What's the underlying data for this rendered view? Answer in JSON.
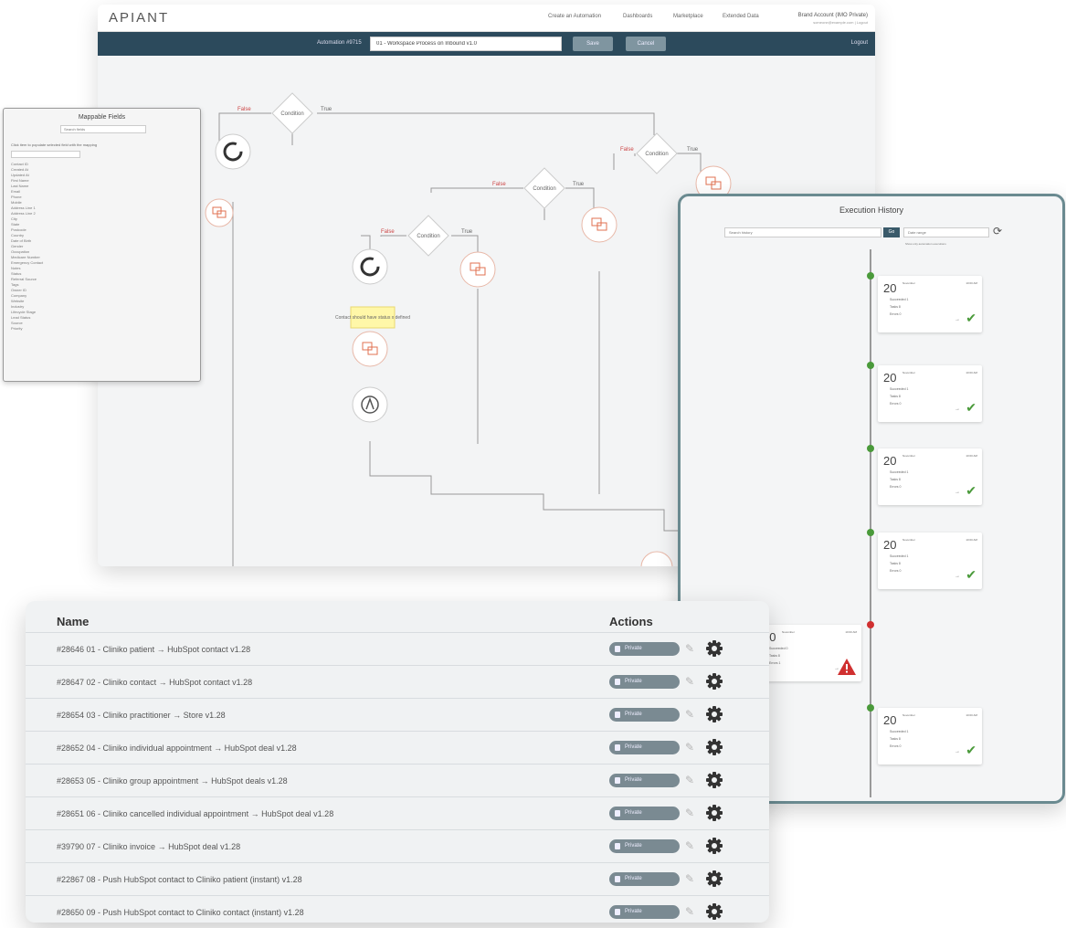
{
  "editor": {
    "logo": "APIANT",
    "nav": [
      "Create an Automation",
      "Dashboards",
      "Marketplace",
      "Extended Data"
    ],
    "user": "Brand Account (IMO Private)",
    "user_sub": "someone@example.com | Logout",
    "automation_label": "Automation #9715",
    "automation_name": "01 - Workspace Process on Inbound v1.0",
    "save_label": "Save",
    "cancel_label": "Cancel",
    "logout_label": "Logout",
    "diagram": {
      "condition_label": "Condition",
      "false_label": "False",
      "true_label": "True",
      "yellow_note": "Contact should have status x defined"
    }
  },
  "mappable": {
    "title": "Mappable Fields",
    "search_placeholder": "Search fields",
    "description": "Click item to populate selected field with the mapping",
    "fields": [
      "Contact ID",
      "Created At",
      "Updated At",
      "First Name",
      "Last Name",
      "Email",
      "Phone",
      "Mobile",
      "Address Line 1",
      "Address Line 2",
      "City",
      "State",
      "Postcode",
      "Country",
      "Date of Birth",
      "Gender",
      "Occupation",
      "Medicare Number",
      "Emergency Contact",
      "Notes",
      "Status",
      "Referral Source",
      "Tags",
      "Owner ID",
      "Company",
      "Website",
      "Industry",
      "Lifecycle Stage",
      "Lead Status",
      "Source",
      "Priority"
    ]
  },
  "history": {
    "title": "Execution History",
    "search_placeholder": "Search history",
    "go_label": "Go",
    "date_placeholder": "Date range",
    "link": "Show only automation executions",
    "entries": [
      {
        "day": "20",
        "month": "November",
        "time": "10:00 AM",
        "l1": "Succeeded 1",
        "l2": "Tasks 8",
        "l3": "Errors 0",
        "status": "success"
      },
      {
        "day": "20",
        "month": "November",
        "time": "10:00 AM",
        "l1": "Succeeded 1",
        "l2": "Tasks 8",
        "l3": "Errors 0",
        "status": "success"
      },
      {
        "day": "20",
        "month": "November",
        "time": "10:00 AM",
        "l1": "Succeeded 1",
        "l2": "Tasks 8",
        "l3": "Errors 0",
        "status": "success"
      },
      {
        "day": "20",
        "month": "November",
        "time": "10:00 AM",
        "l1": "Succeeded 1",
        "l2": "Tasks 8",
        "l3": "Errors 0",
        "status": "success"
      },
      {
        "day": "20",
        "month": "November",
        "time": "10:00 AM",
        "l1": "Succeeded 0",
        "l2": "Tasks 8",
        "l3": "Errors 1",
        "status": "error"
      },
      {
        "day": "20",
        "month": "November",
        "time": "10:00 AM",
        "l1": "Succeeded 1",
        "l2": "Tasks 8",
        "l3": "Errors 0",
        "status": "success"
      }
    ]
  },
  "automations": {
    "header_name": "Name",
    "header_actions": "Actions",
    "badge_label": "Private",
    "rows": [
      {
        "text": "#28646  01 - Cliniko patient → HubSpot contact v1.28"
      },
      {
        "text": "#28647  02 - Cliniko contact → HubSpot contact v1.28"
      },
      {
        "text": "#28654  03 - Cliniko practitioner → Store v1.28"
      },
      {
        "text": "#28652  04 - Cliniko individual appointment → HubSpot deal v1.28"
      },
      {
        "text": "#28653  05 - Cliniko group appointment → HubSpot deals v1.28"
      },
      {
        "text": "#28651  06 - Cliniko cancelled individual appointment → HubSpot deal v1.28"
      },
      {
        "text": "#39790  07 - Cliniko invoice → HubSpot deal v1.28"
      },
      {
        "text": "#22867  08 - Push HubSpot contact to Cliniko patient (instant) v1.28"
      },
      {
        "text": "#28650  09 - Push HubSpot contact to Cliniko contact (instant) v1.28"
      }
    ]
  },
  "colors": {
    "toolbar": "#2c4a5c",
    "frame": "#6a8a90",
    "success": "#4a9a3a",
    "error": "#d03030",
    "node_accent": "#e07050"
  }
}
